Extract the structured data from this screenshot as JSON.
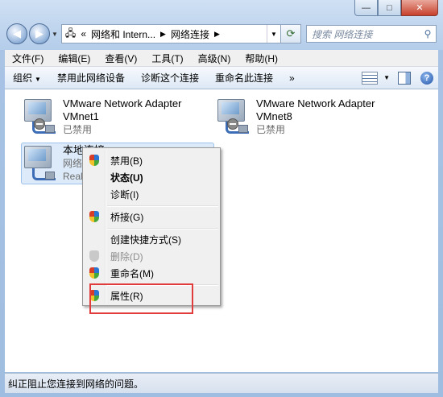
{
  "window": {
    "min_label": "—",
    "max_label": "□",
    "close_label": "✕"
  },
  "nav": {
    "back_icon": "◀",
    "forward_icon": "▶",
    "address": [
      "«",
      "网络和 Intern...",
      "网络连接"
    ],
    "refresh_icon": "⟳",
    "search_placeholder": "搜索 网络连接",
    "search_icon": "⚲"
  },
  "menu": [
    "文件(F)",
    "编辑(E)",
    "查看(V)",
    "工具(T)",
    "高级(N)",
    "帮助(H)"
  ],
  "toolbar": {
    "organize": "组织",
    "disable": "禁用此网络设备",
    "diagnose": "诊断这个连接",
    "rename": "重命名此连接",
    "more": "»",
    "help": "?"
  },
  "connections": [
    {
      "name": "VMware Network Adapter",
      "sub": "VMnet1",
      "status": "已禁用"
    },
    {
      "name": "VMware Network Adapter",
      "sub": "VMnet8",
      "status": "已禁用"
    },
    {
      "name": "本地连接",
      "sub": "网络",
      "status": "Realt"
    }
  ],
  "context_menu": [
    {
      "label": "禁用(B)",
      "icon": "shield-icon"
    },
    {
      "label": "状态(U)",
      "icon": "none"
    },
    {
      "label": "诊断(I)",
      "icon": "none"
    },
    {
      "label": "桥接(G)",
      "icon": "shield-icon"
    },
    {
      "label": "创建快捷方式(S)",
      "icon": "none"
    },
    {
      "label": "删除(D)",
      "icon": "shield-icon"
    },
    {
      "label": "重命名(M)",
      "icon": "shield-icon"
    },
    {
      "label": "属性(R)",
      "icon": "shield-icon"
    }
  ],
  "status_bar": "纠正阻止您连接到网络的问题。",
  "colors": {
    "highlight_box": "#e23b3b",
    "selection": "#dceaf9"
  }
}
